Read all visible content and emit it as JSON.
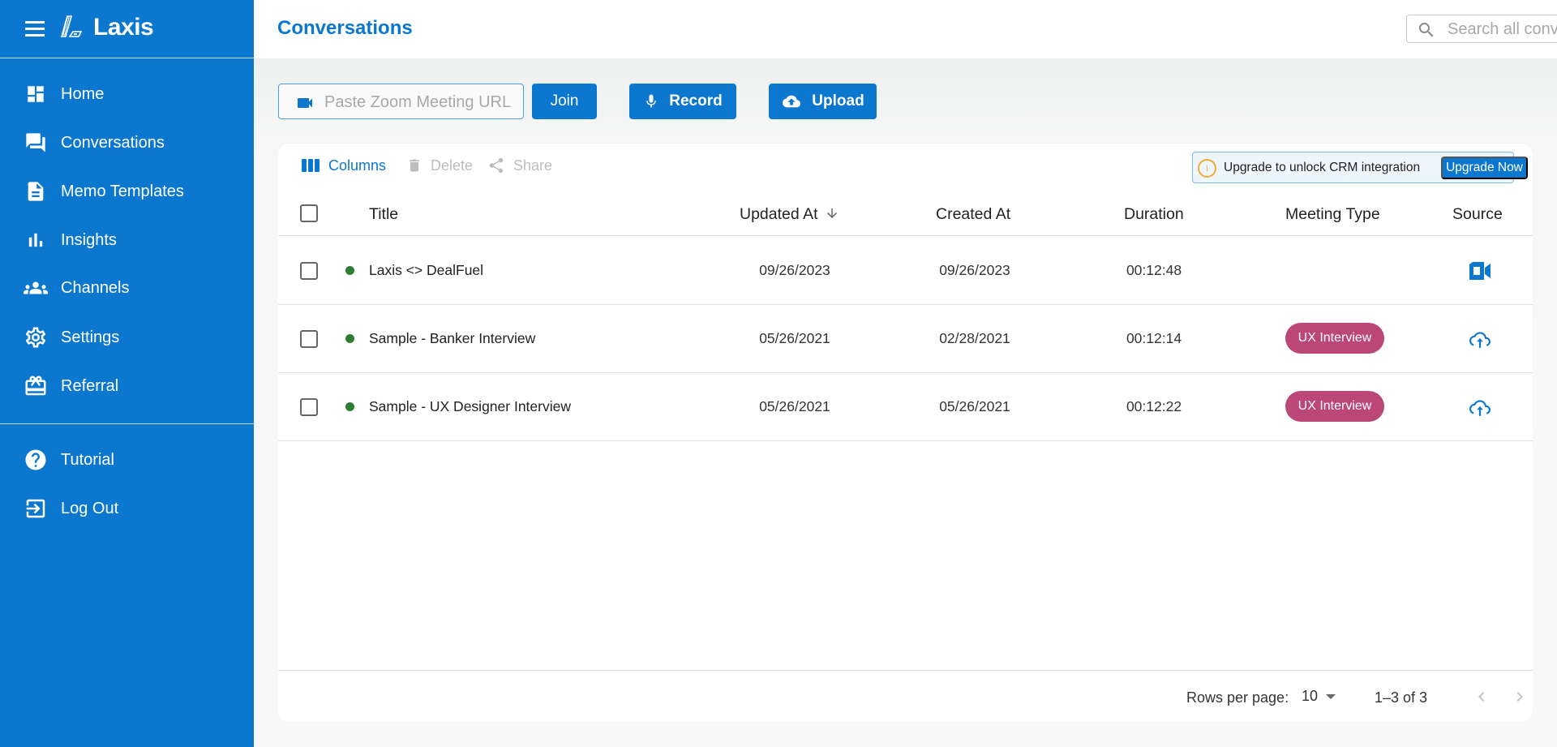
{
  "app": {
    "name": "Laxis"
  },
  "sidebar": {
    "items": [
      {
        "label": "Home",
        "icon": "dashboard-icon"
      },
      {
        "label": "Conversations",
        "icon": "chat-icon"
      },
      {
        "label": "Memo Templates",
        "icon": "document-icon"
      },
      {
        "label": "Insights",
        "icon": "bar-chart-icon"
      },
      {
        "label": "Channels",
        "icon": "groups-icon"
      },
      {
        "label": "Settings",
        "icon": "gear-icon"
      },
      {
        "label": "Referral",
        "icon": "gift-card-icon"
      }
    ],
    "secondary_items": [
      {
        "label": "Tutorial",
        "icon": "help-circle-icon"
      },
      {
        "label": "Log Out",
        "icon": "logout-icon"
      }
    ]
  },
  "header": {
    "title": "Conversations",
    "search_placeholder": "Search all conversations...",
    "search_value": ""
  },
  "actions": {
    "zoom_placeholder": "Paste Zoom Meeting URL",
    "zoom_value": "",
    "join_label": "Join",
    "record_label": "Record",
    "upload_label": "Upload"
  },
  "toolbar": {
    "columns_label": "Columns",
    "delete_label": "Delete",
    "share_label": "Share",
    "upgrade_text": "Upgrade to unlock CRM integration",
    "upgrade_button": "Upgrade Now",
    "info_glyph": "i"
  },
  "table": {
    "columns": [
      "Title",
      "Updated At",
      "Created At",
      "Duration",
      "Meeting Type",
      "Source"
    ],
    "sort": {
      "column": "Updated At",
      "direction": "desc"
    },
    "rows": [
      {
        "title": "Laxis <> DealFuel",
        "updated_at": "09/26/2023",
        "created_at": "09/26/2023",
        "duration": "00:12:48",
        "meeting_type": "",
        "source": "zoom-icon",
        "status": "active"
      },
      {
        "title": "Sample - Banker Interview",
        "updated_at": "05/26/2021",
        "created_at": "02/28/2021",
        "duration": "00:12:14",
        "meeting_type": "UX Interview",
        "source": "cloud-upload-icon",
        "status": "active"
      },
      {
        "title": "Sample - UX Designer Interview",
        "updated_at": "05/26/2021",
        "created_at": "05/26/2021",
        "duration": "00:12:22",
        "meeting_type": "UX Interview",
        "source": "cloud-upload-icon",
        "status": "active"
      }
    ]
  },
  "pagination": {
    "rows_per_page_label": "Rows per page:",
    "rows_per_page": "10",
    "range": "1–3 of 3"
  },
  "colors": {
    "brand": "#0b77cf",
    "chip": "#bb4677",
    "status_active": "#2e7d32",
    "warning": "#f3a833"
  }
}
